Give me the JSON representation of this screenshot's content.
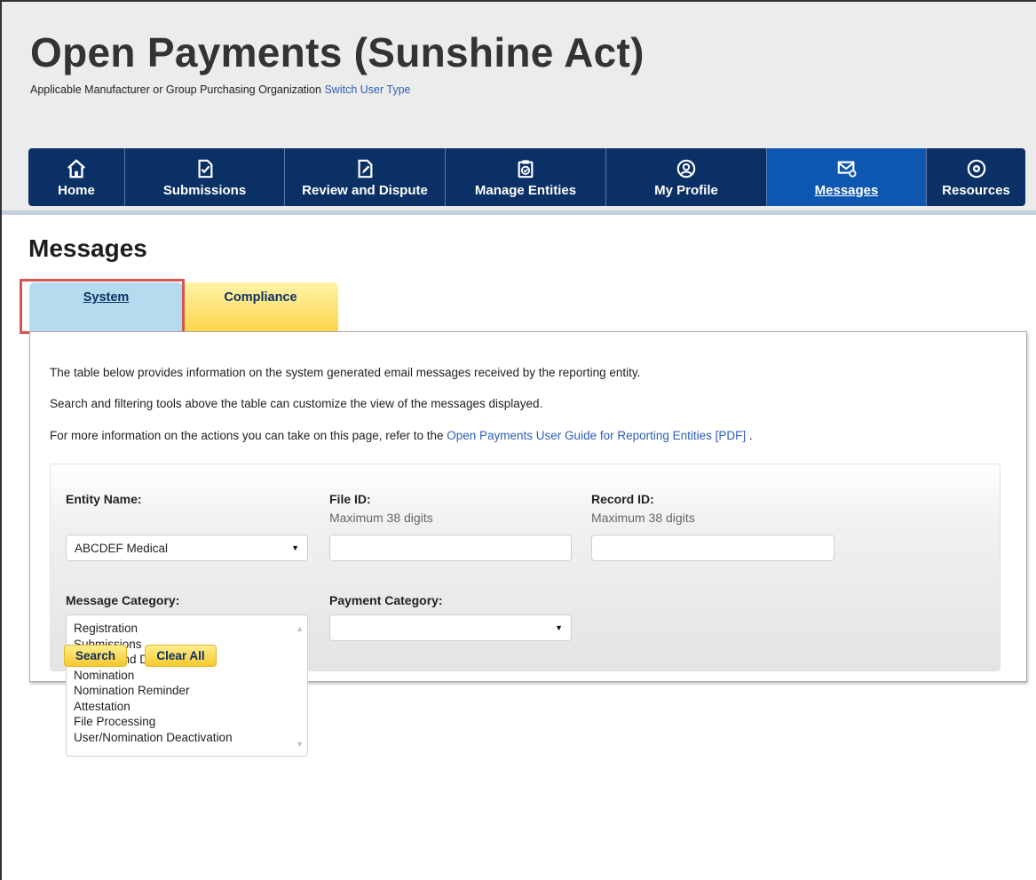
{
  "header": {
    "title": "Open Payments (Sunshine Act)",
    "user_type": "Applicable Manufacturer or Group Purchasing Organization",
    "switch_link": "Switch User Type"
  },
  "nav": {
    "items": [
      {
        "label": "Home",
        "icon": "home-icon"
      },
      {
        "label": "Submissions",
        "icon": "document-check-icon"
      },
      {
        "label": "Review and Dispute",
        "icon": "document-edit-icon"
      },
      {
        "label": "Manage Entities",
        "icon": "clipboard-check-icon"
      },
      {
        "label": "My Profile",
        "icon": "user-circle-icon"
      },
      {
        "label": "Messages",
        "icon": "envelope-icon",
        "active": true
      },
      {
        "label": "Resources",
        "icon": "gear-icon"
      }
    ]
  },
  "page": {
    "title": "Messages",
    "tabs": [
      {
        "label": "System",
        "active": true
      },
      {
        "label": "Compliance"
      }
    ]
  },
  "info": {
    "line1": "The table below provides information on the system generated email messages received by the reporting entity.",
    "line2": "Search and filtering tools above the table can customize the view of the messages displayed.",
    "line3_prefix": "For more information on the actions you can take on this page, refer to the ",
    "line3_link": "Open Payments User Guide for Reporting Entities [PDF]",
    "line3_suffix": " ."
  },
  "search": {
    "entity_name_label": "Entity Name:",
    "entity_name_value": "ABCDEF Medical",
    "file_id_label": "File ID:",
    "file_id_hint": "Maximum 38 digits",
    "file_id_value": "",
    "record_id_label": "Record ID:",
    "record_id_hint": "Maximum 38 digits",
    "record_id_value": "",
    "message_category_label": "Message Category:",
    "message_categories": [
      "Registration",
      "Submissions",
      "Review and Dispute",
      "Nomination",
      "Nomination Reminder",
      "Attestation",
      "File Processing",
      "User/Nomination Deactivation"
    ],
    "payment_category_label": "Payment Category:",
    "payment_category_value": "",
    "search_button": "Search",
    "clear_button": "Clear All"
  },
  "colors": {
    "nav_bg": "#0a3065",
    "nav_active": "#0e57b0",
    "tab_system": "#b5dcee",
    "tab_compliance": "#fcd64a",
    "link": "#2b5fb4",
    "highlight": "#d9534f"
  }
}
